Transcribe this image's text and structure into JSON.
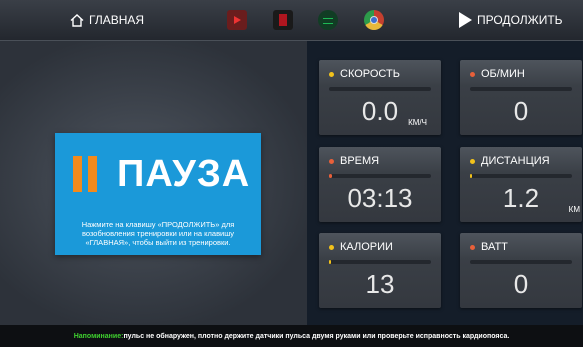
{
  "topbar": {
    "home_label": "ГЛАВНАЯ",
    "continue_label": "ПРОДОЛЖИТЬ",
    "apps": [
      "youtube-icon",
      "netflix-icon",
      "spotify-icon",
      "chrome-icon"
    ]
  },
  "pause": {
    "title": "ПАУЗА",
    "message": "Нажмите на клавишу «ПРОДОЛЖИТЬ» для возобновления тренировки или на клавишу «ГЛАВНАЯ», чтобы выйти из тренировки.",
    "accent": "#1b99d9",
    "bar_color": "#f28a1c"
  },
  "metrics": {
    "speed": {
      "label": "СКОРОСТЬ",
      "value": "0.0",
      "unit": "КМ/Ч",
      "dot": "#f2c21b",
      "fill_color": "#f2c21b",
      "progress": 0
    },
    "rpm": {
      "label": "ОБ/МИН",
      "value": "0",
      "dot": "#e8603a",
      "fill_color": "#e8603a",
      "progress": 0
    },
    "time": {
      "label": "ВРЕМЯ",
      "value": "03:13",
      "dot": "#e8603a",
      "fill_color": "#e8603a",
      "progress": 0.03
    },
    "distance": {
      "label": "ДИСТАНЦИЯ",
      "value": "1.2",
      "unit": "КМ",
      "dot": "#f2c21b",
      "fill_color": "#f2c21b",
      "progress": 0.01
    },
    "calories": {
      "label": "КАЛОРИИ",
      "value": "13",
      "dot": "#f2c21b",
      "fill_color": "#f2c21b",
      "progress": 0.01
    },
    "watt": {
      "label": "ВАТТ",
      "value": "0",
      "dot": "#e8603a",
      "fill_color": "#e8603a",
      "progress": 0
    }
  },
  "reminder": {
    "label": "Напоминание:",
    "text": "пульс не обнаружен, плотно держите датчики пульса двумя руками или проверьте исправность кардиопояса."
  }
}
